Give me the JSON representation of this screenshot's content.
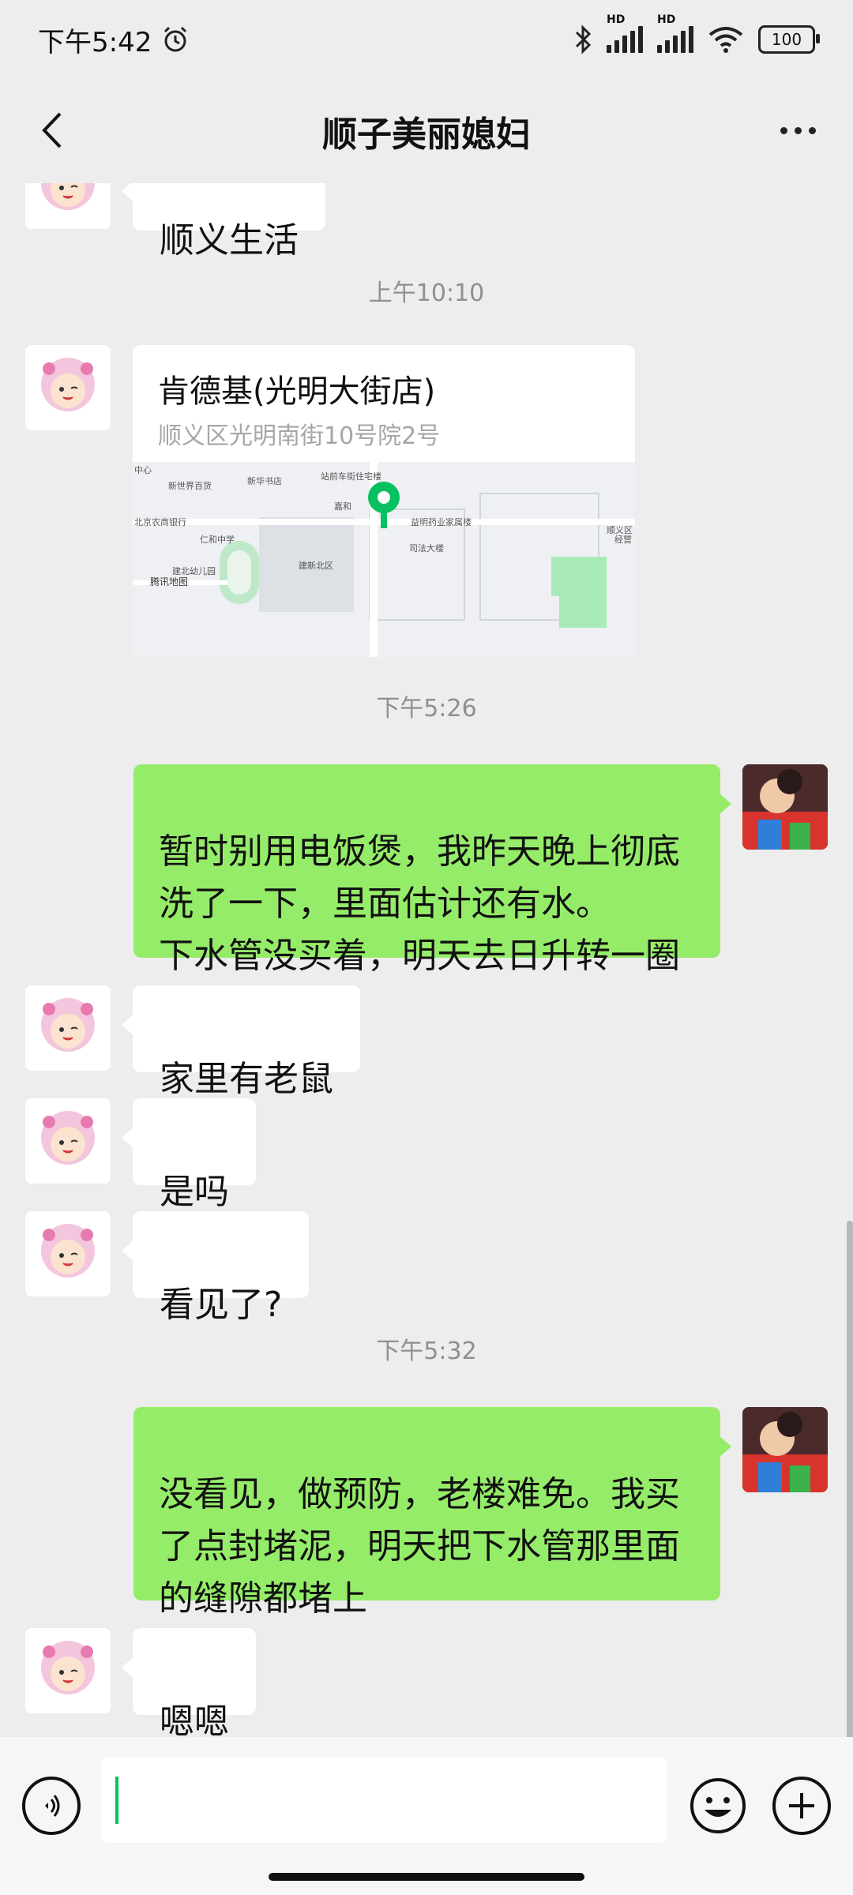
{
  "status_bar": {
    "time": "下午5:42",
    "battery": "100",
    "hd_label_1": "HD",
    "hd_label_2": "HD"
  },
  "nav": {
    "title": "顺子美丽媳妇"
  },
  "messages": [
    {
      "type": "text",
      "side": "left",
      "text": "顺义生活"
    },
    {
      "type": "timestamp",
      "text": "上午10:10"
    },
    {
      "type": "location",
      "side": "left",
      "name": "肯德基(光明大街店)",
      "address": "顺义区光明南街10号院2号",
      "map_labels": [
        "中心",
        "新世界百货",
        "新华书店",
        "站前车街住宅楼",
        "嘉和",
        "北京农商银行",
        "仁和中学",
        "益明药业家属楼",
        "司法大楼",
        "建北幼儿园",
        "建新北区",
        "腾讯地图",
        "顺义区",
        "经营"
      ]
    },
    {
      "type": "timestamp",
      "text": "下午5:26"
    },
    {
      "type": "text",
      "side": "right",
      "text": "暂时别用电饭煲，我昨天晚上彻底\n洗了一下，里面估计还有水。\n下水管没买着，明天去日升转一圈"
    },
    {
      "type": "text",
      "side": "left",
      "text": "家里有老鼠"
    },
    {
      "type": "text",
      "side": "left",
      "text": "是吗"
    },
    {
      "type": "text",
      "side": "left",
      "text": "看见了?"
    },
    {
      "type": "timestamp",
      "text": "下午5:32"
    },
    {
      "type": "text",
      "side": "right",
      "text": "没看见，做预防，老楼难免。我买\n了点封堵泥，明天把下水管那里面\n的缝隙都堵上"
    },
    {
      "type": "text",
      "side": "left",
      "text": "嗯嗯"
    }
  ],
  "input": {
    "value": ""
  },
  "colors": {
    "self_bubble": "#95ec69",
    "other_bubble": "#ffffff",
    "background": "#ededed",
    "map_pin": "#07c160"
  },
  "icons": [
    "back-icon",
    "more-icon",
    "voice-icon",
    "emoji-icon",
    "plus-icon",
    "map-pin-icon",
    "bluetooth-icon",
    "wifi-icon",
    "alarm-icon"
  ]
}
